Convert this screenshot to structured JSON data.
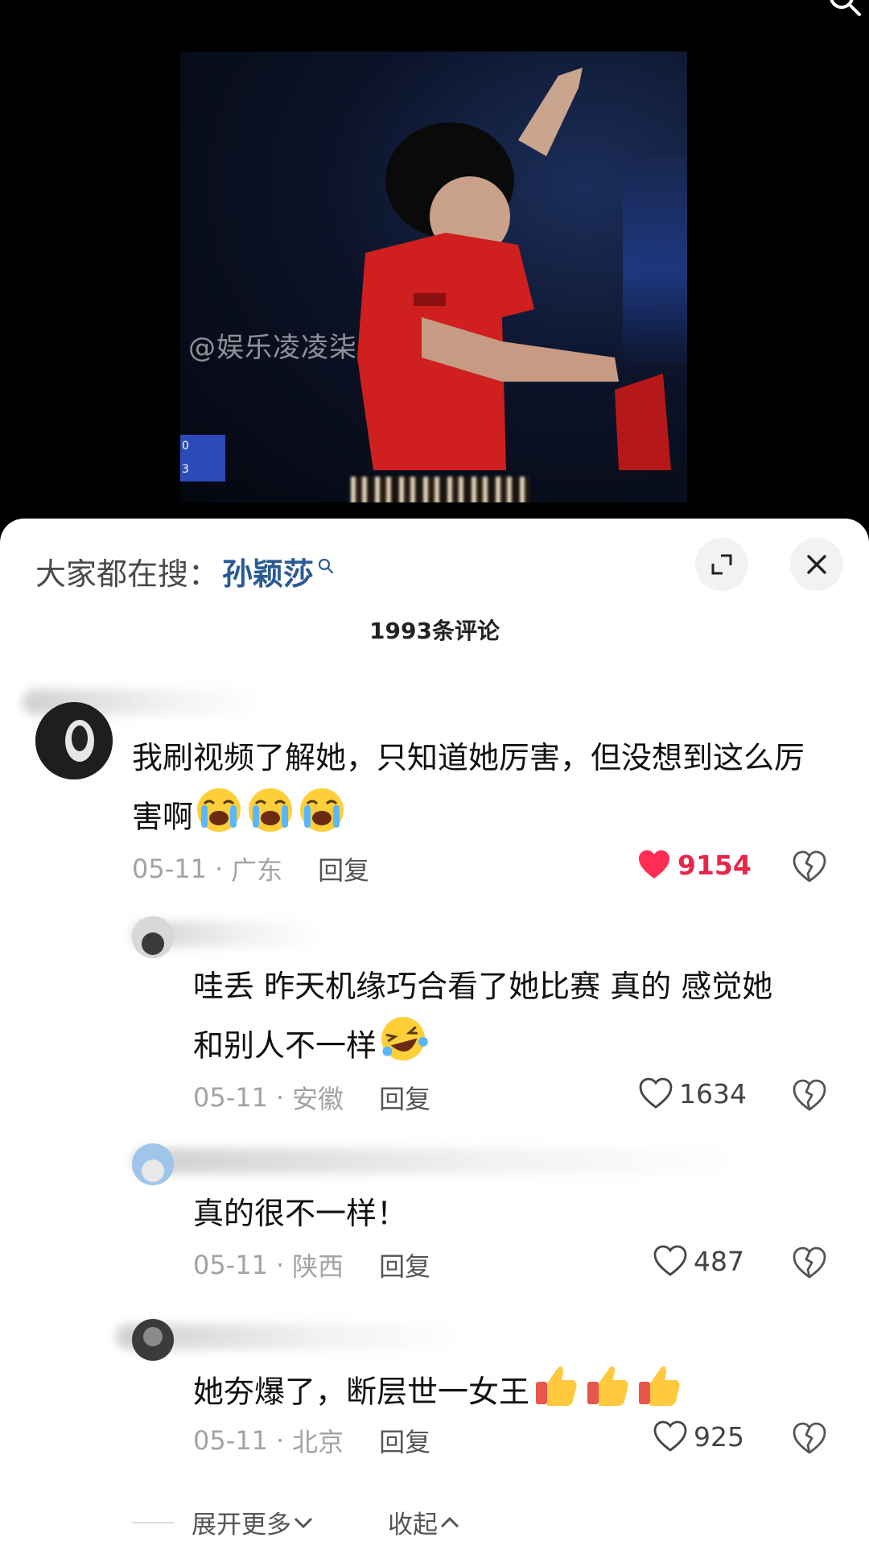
{
  "video": {
    "watermark": "@娱乐凌凌柒",
    "score": [
      "0",
      "3"
    ]
  },
  "header": {
    "hot_search_prefix": "大家都在搜：",
    "hot_search_keyword": "孙颖莎",
    "comment_count": "1993条评论"
  },
  "comments": [
    {
      "text_line1": "我刷视频了解她，只知道她厉害，但没想到这么厉",
      "text_line2": "害啊",
      "date": "05-11",
      "region": "广东",
      "reply_label": "回复",
      "likes": "9154",
      "liked": true,
      "emoji": "crying-face"
    },
    {
      "text_line1": "哇丢  昨天机缘巧合看了她比赛 真的  感觉她",
      "text_line2": "和别人不一样",
      "date": "05-11",
      "region": "安徽",
      "reply_label": "回复",
      "likes": "1634",
      "liked": false,
      "emoji": "laughing-face"
    },
    {
      "text_line1": "真的很不一样！",
      "date": "05-11",
      "region": "陕西",
      "reply_label": "回复",
      "likes": "487",
      "liked": false
    },
    {
      "text_line1": "她夯爆了，断层世一女王",
      "date": "05-11",
      "region": "北京",
      "reply_label": "回复",
      "likes": "925",
      "liked": false,
      "emoji": "thumbs-up"
    }
  ],
  "footer": {
    "expand_more": "展开更多",
    "collapse": "收起"
  },
  "colors": {
    "accent_like": "#e8264a",
    "keyword": "#2b5a96"
  }
}
